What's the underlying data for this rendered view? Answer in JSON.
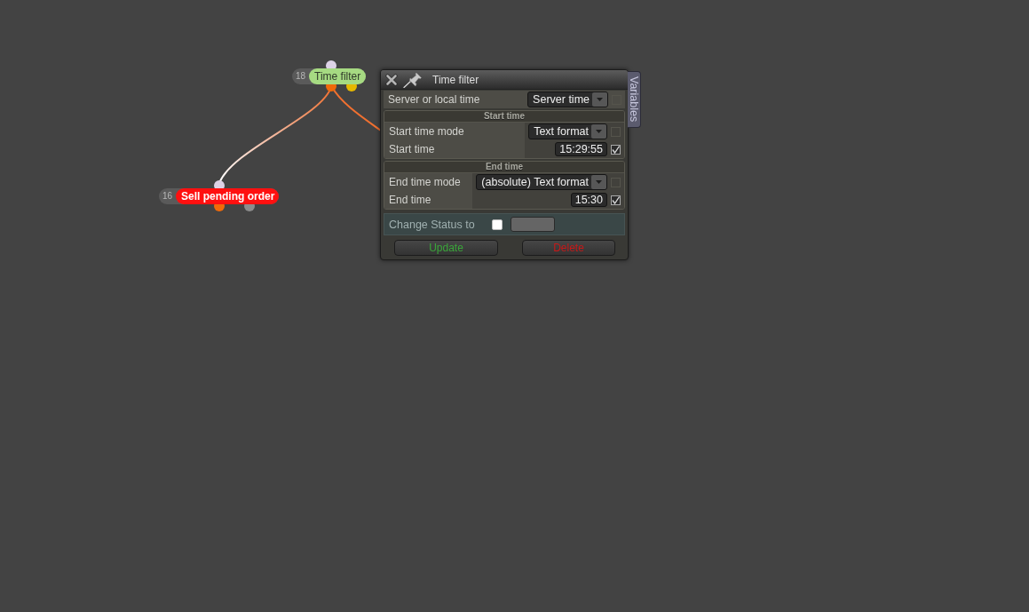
{
  "canvas": {
    "nodes": [
      {
        "number": "18",
        "label": "Time filter",
        "kind": "condition",
        "color": "#a6da82",
        "outputs": [
          {
            "color": "#f06a0a"
          },
          {
            "color": "#e6b800"
          }
        ]
      },
      {
        "number": "16",
        "label": "Sell pending order",
        "kind": "action",
        "color": "#ff1010",
        "outputs": [
          {
            "color": "#f06a0a"
          },
          {
            "color": "#8c8c8c"
          }
        ]
      }
    ]
  },
  "panel": {
    "title": "Time filter",
    "side_tab": "Variables",
    "fields": [
      {
        "label": "Server or local time",
        "kind": "select",
        "value": "Server time",
        "checked": false
      }
    ],
    "sections": [
      {
        "title": "Start time",
        "fields": [
          {
            "label": "Start time mode",
            "kind": "select",
            "value": "Text format",
            "checked": false
          },
          {
            "label": "Start time",
            "kind": "text",
            "value": "15:29:55",
            "checked": true
          }
        ]
      },
      {
        "title": "End time",
        "fields": [
          {
            "label": "End time mode",
            "kind": "select",
            "value": "(absolute) Text format",
            "checked": false
          },
          {
            "label": "End time",
            "kind": "text",
            "value": "15:30",
            "checked": true
          }
        ]
      }
    ],
    "status_row": {
      "label": "Change Status to",
      "checked": false
    },
    "buttons": [
      {
        "label": "Update",
        "kind": "confirm"
      },
      {
        "label": "Delete",
        "kind": "danger"
      }
    ]
  }
}
